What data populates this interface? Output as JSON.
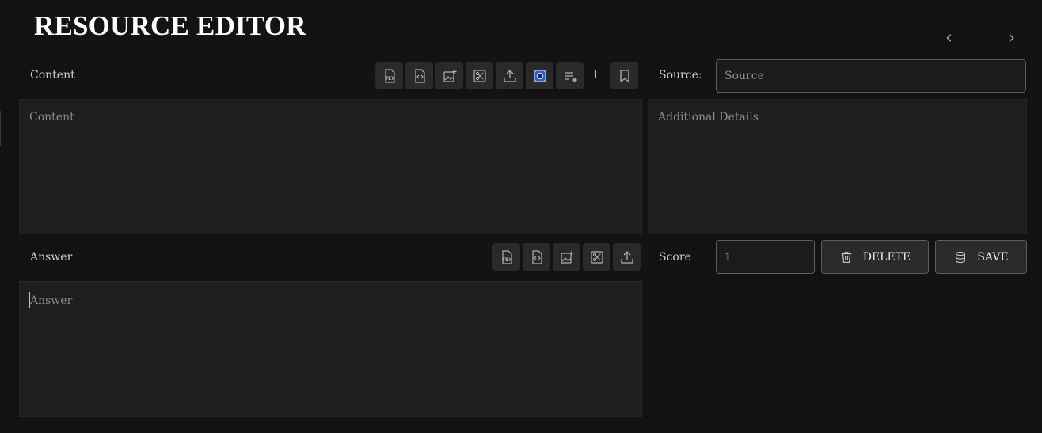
{
  "header": {
    "title": "RESOURCE EDITOR"
  },
  "nav": {
    "prev_icon": "chevron-left-icon",
    "next_icon": "chevron-right-icon"
  },
  "content_section": {
    "label": "Content",
    "placeholder": "Content",
    "toolbar": [
      "tex-file-icon",
      "code-file-icon",
      "image-add-icon",
      "scissors-icon",
      "upload-icon",
      "photo-blue-icon",
      "clear-format-icon",
      "bookmark-icon"
    ]
  },
  "source": {
    "label": "Source:",
    "placeholder": "Source"
  },
  "details": {
    "placeholder": "Additional Details"
  },
  "answer_section": {
    "label": "Answer",
    "placeholder": "Answer",
    "toolbar": [
      "tex-file-icon",
      "code-file-icon",
      "image-add-icon",
      "scissors-icon",
      "upload-icon"
    ]
  },
  "score": {
    "label": "Score",
    "value": "1"
  },
  "actions": {
    "delete_label": "DELETE",
    "save_label": "SAVE"
  },
  "colors": {
    "background": "#131313",
    "panel": "#1e1e1e",
    "button": "#2a2a2a",
    "accent_blue": "#2f5bd8"
  }
}
